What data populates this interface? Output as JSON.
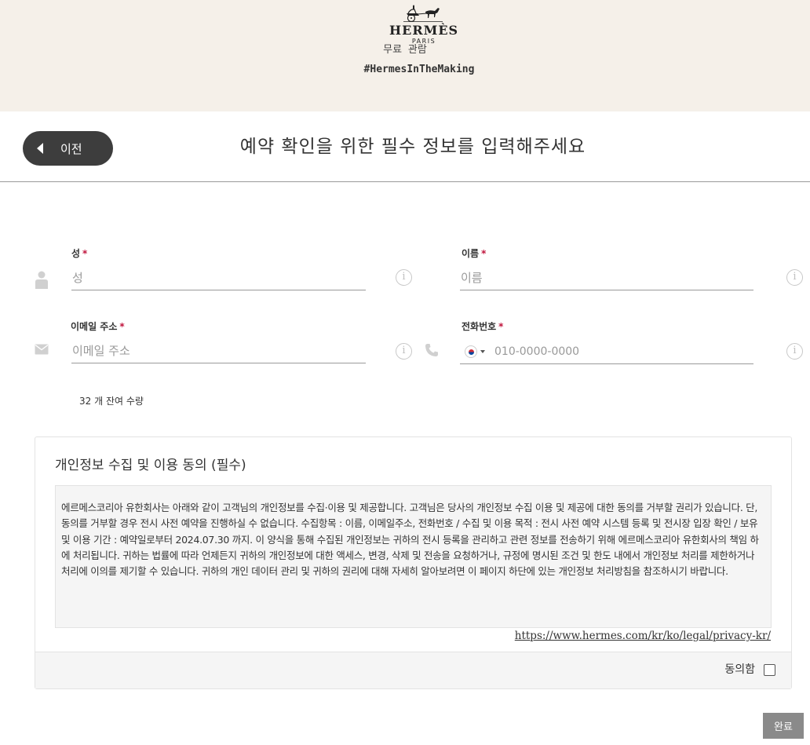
{
  "header": {
    "brand": "HERMÈS",
    "brand_sub": "PARIS",
    "free_label": "무료 관람",
    "hashtag": "#HermesInTheMaking"
  },
  "title_bar": {
    "back_label": "이전",
    "page_title": "예약 확인을 위한 필수 정보를 입력해주세요"
  },
  "form": {
    "last_name": {
      "label": "성",
      "placeholder": "성",
      "required_mark": "*"
    },
    "first_name": {
      "label": "이름",
      "placeholder": "이름",
      "required_mark": "*"
    },
    "email": {
      "label": "이메일 주소",
      "placeholder": "이메일 주소",
      "required_mark": "*"
    },
    "phone": {
      "label": "전화번호",
      "placeholder": "010-0000-0000",
      "required_mark": "*",
      "country_flag": "KR"
    },
    "info_glyph": "i",
    "remaining": "32 개 잔여 수량"
  },
  "consent": {
    "title": "개인정보 수집 및 이용 동의 (필수)",
    "text": "에르메스코리아 유한회사는 아래와 같이 고객님의 개인정보를 수집·이용 및 제공합니다. 고객님은 당사의 개인정보 수집 이용 및 제공에 대한 동의를 거부할 권리가 있습니다. 단, 동의를 거부할 경우 전시 사전 예약을 진행하실 수 없습니다. 수집항목 : 이름, 이메일주소, 전화번호 / 수집 및 이용 목적 : 전시 사전 예약 시스템 등록 및 전시장 입장 확인 / 보유 및 이용 기간 : 예약일로부터 2024.07.30 까지. 이 양식을 통해 수집된 개인정보는 귀하의 전시 등록을 관리하고 관련 정보를 전송하기 위해 에르메스코리아 유한회사의 책임 하에 처리됩니다. 귀하는 법률에 따라 언제든지 귀하의 개인정보에 대한 액세스, 변경, 삭제 및 전송을 요청하거나, 규정에 명시된 조건 및 한도 내에서 개인정보 처리를 제한하거나 처리에 이의를 제기할 수 있습니다. 귀하의 개인 데이터 관리 및 귀하의 권리에 대해 자세히 알아보려면 이 페이지 하단에 있는 개인정보 처리방침을 참조하시기 바랍니다.",
    "link": "https://www.hermes.com/kr/ko/legal/privacy-kr/",
    "agree_label": "동의함"
  },
  "actions": {
    "done_label": "완료"
  },
  "colors": {
    "banner_bg": "#f5f0e9",
    "back_button_bg": "#3d3d3d",
    "required_mark": "#c0143c",
    "done_button_bg": "#8a8a8a"
  },
  "icons": {
    "logo": "hermes-horse-carriage-logo",
    "user": "person-icon",
    "email": "envelope-icon",
    "phone": "phone-icon",
    "info": "info-circle-icon",
    "back": "caret-left-icon",
    "flag": "korea-flag-icon"
  }
}
